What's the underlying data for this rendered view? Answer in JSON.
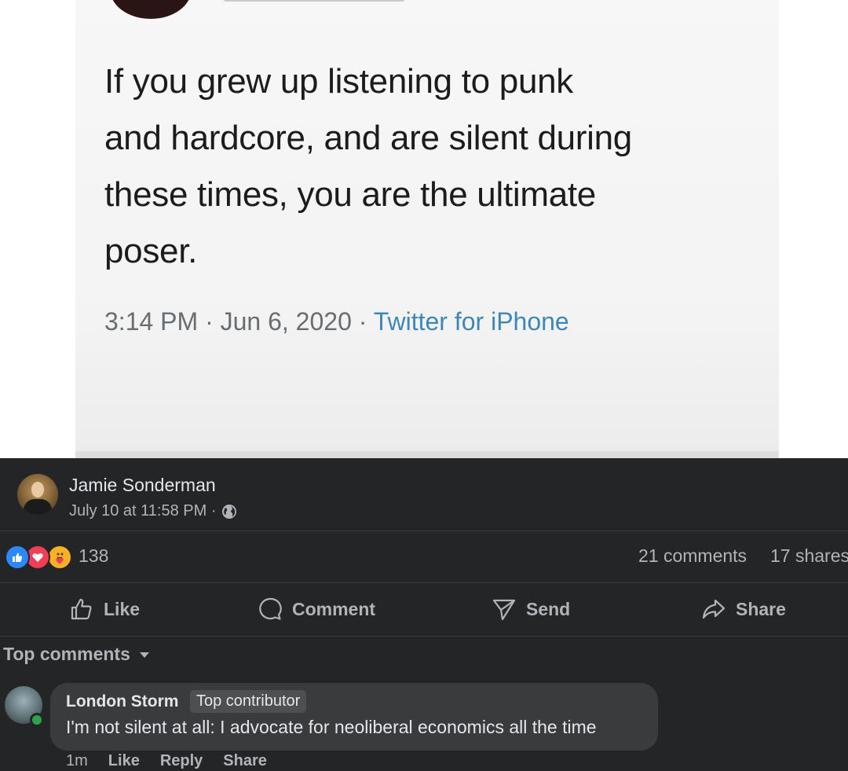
{
  "tweet": {
    "text": "If you grew up listening to punk\nand hardcore, and are silent during\nthese times, you are the ultimate\nposer.",
    "time": "3:14 PM",
    "date": "Jun 6, 2020",
    "separator": " · ",
    "source": "Twitter for iPhone"
  },
  "post": {
    "author": "Jamie Sonderman",
    "timestamp": "July 10 at 11:58 PM ·",
    "reactions_count": "138",
    "comments_count": "21 comments",
    "shares_count": "17 shares",
    "reaction_icons": [
      "like",
      "love",
      "care"
    ]
  },
  "actions": {
    "like": "Like",
    "comment": "Comment",
    "send": "Send",
    "share": "Share"
  },
  "comments_section": {
    "sort_label": "Top comments",
    "items": [
      {
        "author": "London Storm",
        "badge": "Top contributor",
        "text": "I'm not silent at all: I advocate for neoliberal economics all the time",
        "age": "1m",
        "like": "Like",
        "reply": "Reply",
        "share": "Share"
      }
    ]
  },
  "colors": {
    "fb_background": "#242526",
    "primary_text": "#e4e6eb",
    "secondary_text": "#b0b3b8",
    "like_blue": "#2d88ff",
    "love_red": "#f33e58",
    "care_yellow": "#f7b125",
    "tweet_link": "#3e88b8",
    "online_green": "#31a24c"
  }
}
